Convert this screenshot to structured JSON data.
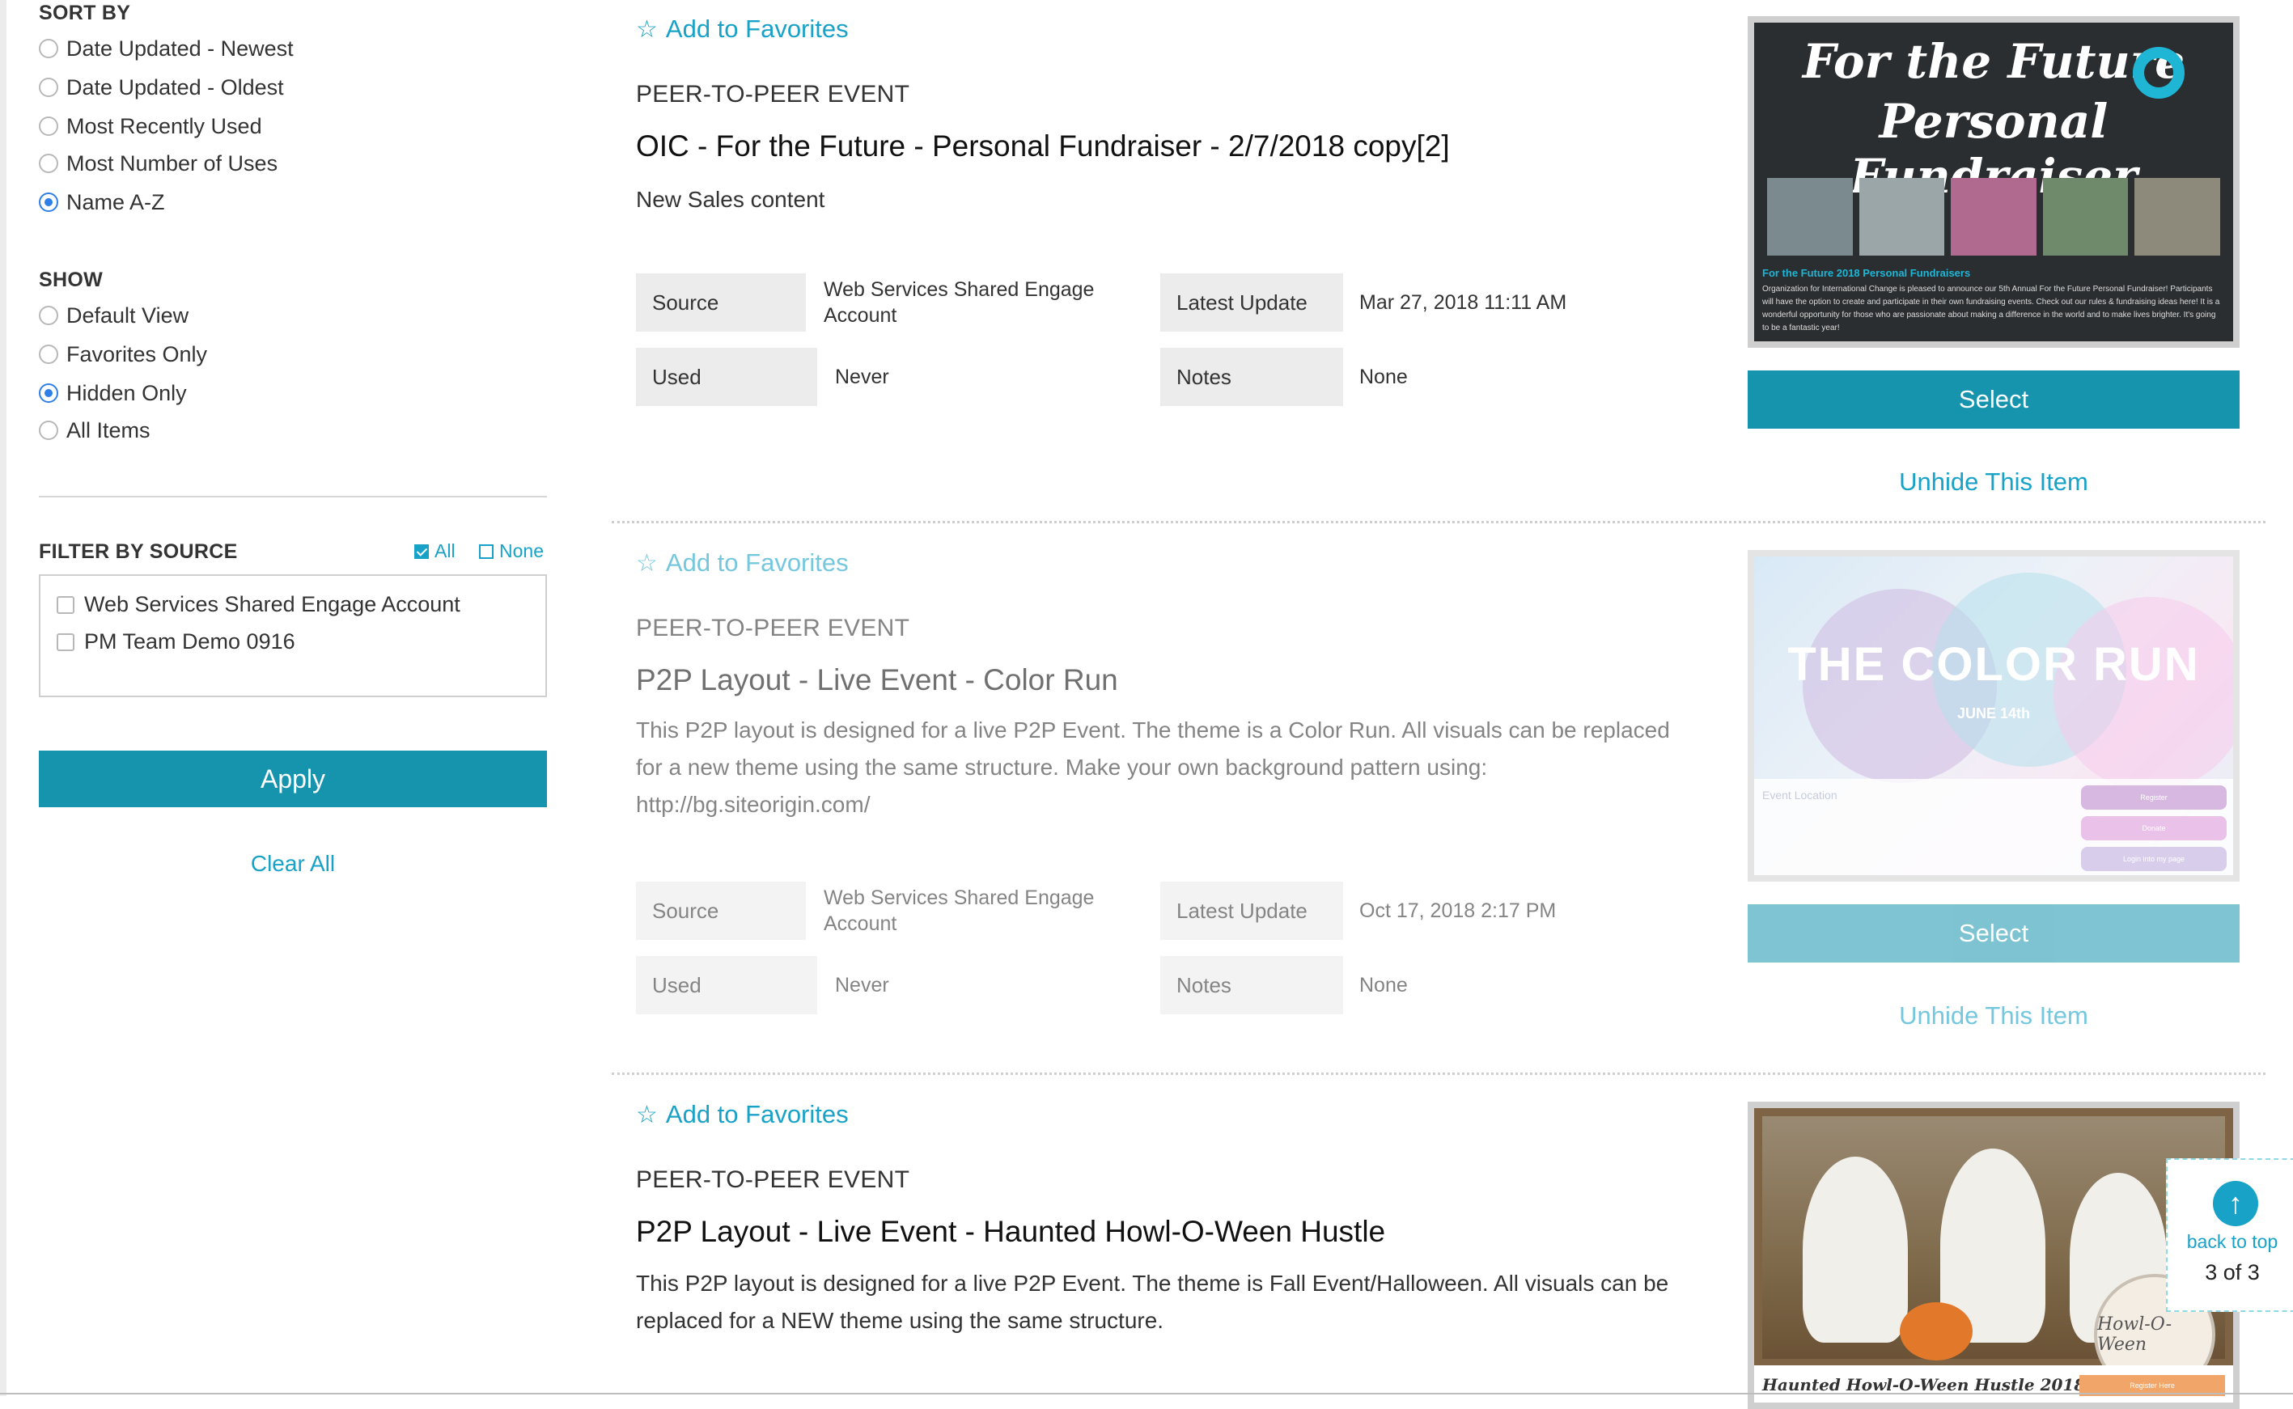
{
  "sidebar": {
    "sort_by": {
      "title": "SORT BY",
      "options": [
        {
          "label": "Date Updated - Newest",
          "selected": false
        },
        {
          "label": "Date Updated - Oldest",
          "selected": false
        },
        {
          "label": "Most Recently Used",
          "selected": false
        },
        {
          "label": "Most Number of Uses",
          "selected": false
        },
        {
          "label": "Name A-Z",
          "selected": true
        }
      ]
    },
    "show": {
      "title": "SHOW",
      "options": [
        {
          "label": "Default View",
          "selected": false
        },
        {
          "label": "Favorites Only",
          "selected": false
        },
        {
          "label": "Hidden Only",
          "selected": true
        },
        {
          "label": "All Items",
          "selected": false
        }
      ]
    },
    "filter": {
      "title": "FILTER BY SOURCE",
      "all_label": "All",
      "all_checked": true,
      "none_label": "None",
      "none_checked": false,
      "sources": [
        {
          "label": "Web Services Shared Engage Account",
          "checked": false
        },
        {
          "label": "PM Team Demo 0916",
          "checked": false
        }
      ]
    },
    "apply_label": "Apply",
    "clear_label": "Clear All"
  },
  "labels": {
    "add_favorites": "Add to Favorites",
    "source": "Source",
    "latest_update": "Latest Update",
    "used": "Used",
    "notes": "Notes",
    "select": "Select",
    "unhide": "Unhide This Item"
  },
  "items": [
    {
      "type": "PEER-TO-PEER EVENT",
      "title": "OIC - For the Future - Personal Fundraiser - 2/7/2018 copy[2]",
      "description": "New Sales content",
      "source": "Web Services Shared Engage Account",
      "latest_update": "Mar 27, 2018 11:11 AM",
      "used": "Never",
      "notes": "None",
      "thumbnail": {
        "heading_1": "For the Future",
        "heading_2": "Personal Fundraiser",
        "caption": "For the Future 2018 Personal Fundraisers",
        "blurb": "Organization for International Change is pleased to announce our 5th Annual For the Future Personal Fundraiser! Participants will have the option to create and participate in their own fundraising events. Check out our rules & fundraising ideas here! It is a wonderful opportunity for those who are passionate about making a difference in the world and to make lives brighter. It's going to be a fantastic year!"
      }
    },
    {
      "type": "PEER-TO-PEER EVENT",
      "title": "P2P Layout - Live Event - Color Run",
      "description": "This P2P layout is designed for a live P2P Event. The theme is a Color Run. All visuals can be replaced for a new theme using the same structure. Make your own background pattern using: http://bg.siteorigin.com/",
      "source": "Web Services Shared Engage Account",
      "latest_update": "Oct 17, 2018 2:17 PM",
      "used": "Never",
      "notes": "None",
      "thumbnail": {
        "heading": "THE COLOR RUN",
        "subheading": "JUNE 14th",
        "location_label": "Event Location",
        "btn_register": "Register",
        "btn_donate": "Donate",
        "btn_login": "Login into my page"
      }
    },
    {
      "type": "PEER-TO-PEER EVENT",
      "title": "P2P Layout - Live Event - Haunted Howl-O-Ween Hustle",
      "description": "This P2P layout is designed for a live P2P Event. The theme is Fall Event/Halloween. All visuals can be replaced for a NEW theme using the same structure.",
      "thumbnail": {
        "badge": "Howl-O-Ween",
        "caption": "Haunted Howl-O-Ween Hustle 2018",
        "btn_register": "Register Here"
      }
    }
  ],
  "back_to_top": {
    "label": "back to top",
    "page": "3 of 3"
  },
  "colors": {
    "accent": "#18a2c7",
    "button": "#1693ad",
    "radio_selected": "#2f7fe8"
  }
}
